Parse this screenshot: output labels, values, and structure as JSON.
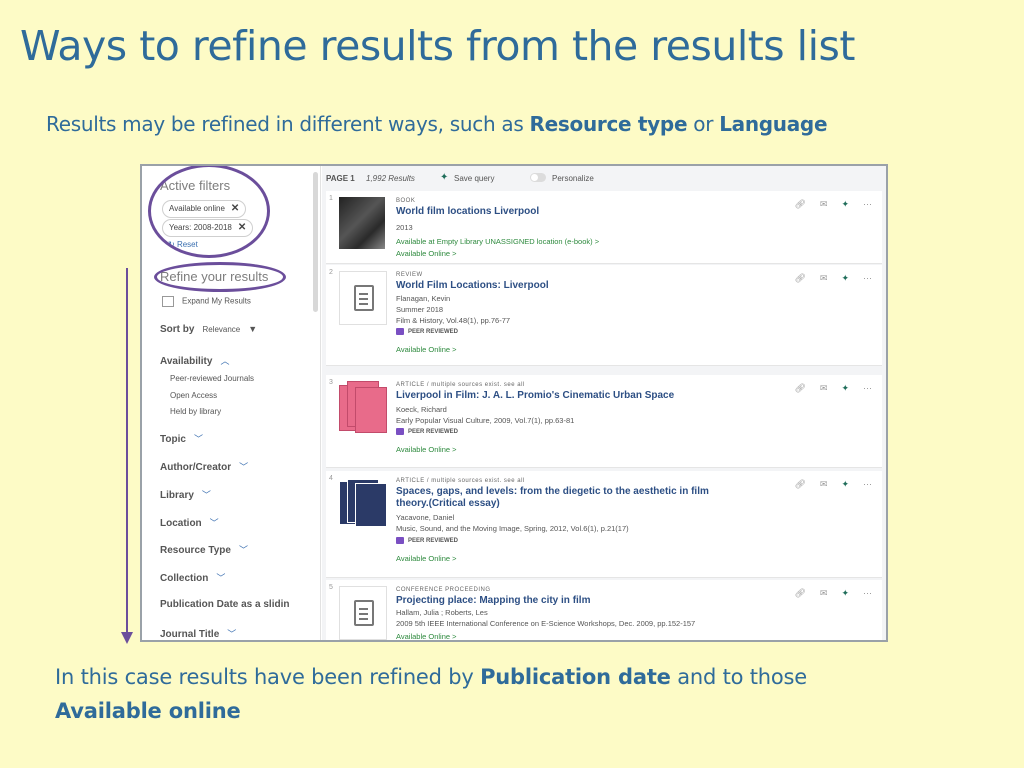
{
  "slide": {
    "title": "Ways to refine results from the results list",
    "intro_prefix": "Results may be refined in different ways, such as ",
    "intro_bold1": "Resource type",
    "intro_mid": " or ",
    "intro_bold2": "Language",
    "footer_prefix": "In this case results have been refined by ",
    "footer_bold1": "Publication date",
    "footer_mid": " and to those ",
    "footer_bold2": "Available online"
  },
  "sidebar": {
    "active_filters": "Active filters",
    "chips": [
      "Available online",
      "Years: 2008-2018"
    ],
    "reset": "Reset",
    "refine": "Refine your results",
    "expand": "Expand My Results",
    "sort_label": "Sort by",
    "sort_value": "Relevance",
    "availability": "Availability",
    "availability_items": [
      "Peer-reviewed Journals",
      "Open Access",
      "Held by library"
    ],
    "facets": [
      "Topic",
      "Author/Creator",
      "Library",
      "Location",
      "Resource Type",
      "Collection",
      "Publication Date as a slidin",
      "Journal Title"
    ]
  },
  "topbar": {
    "page": "PAGE 1",
    "count": "1,992 Results",
    "save": "Save query",
    "personalize": "Personalize"
  },
  "results": [
    {
      "num": "1",
      "type": "BOOK",
      "title": "World film locations Liverpool",
      "meta": [
        "2013"
      ],
      "peer": "",
      "avail": [
        "Available at Empty Library  UNASSIGNED location (e-book)  >",
        "Available Online  >"
      ]
    },
    {
      "num": "2",
      "type": "REVIEW",
      "title": "World Film Locations: Liverpool",
      "meta": [
        "Flanagan, Kevin",
        "Summer 2018",
        "Film & History, Vol.48(1), pp.76-77"
      ],
      "peer": "PEER REVIEWED",
      "avail": [
        "Available Online  >"
      ]
    },
    {
      "num": "3",
      "type": "ARTICLE / multiple sources exist. see all",
      "title": "Liverpool in Film: J. A. L. Promio's Cinematic Urban Space",
      "meta": [
        "Koeck, Richard",
        "Early Popular Visual Culture, 2009, Vol.7(1), pp.63-81"
      ],
      "peer": "PEER REVIEWED",
      "avail": [
        "Available Online  >"
      ]
    },
    {
      "num": "4",
      "type": "ARTICLE / multiple sources exist. see all",
      "title": "Spaces, gaps, and levels: from the diegetic to the aesthetic in film theory.(Critical essay)",
      "meta": [
        "Yacavone, Daniel",
        "Music, Sound, and the Moving Image, Spring, 2012, Vol.6(1), p.21(17)"
      ],
      "peer": "PEER REVIEWED",
      "avail": [
        "Available Online  >"
      ]
    },
    {
      "num": "5",
      "type": "CONFERENCE PROCEEDING",
      "title": "Projecting place: Mapping the city in film",
      "meta": [
        "Hallam, Julia ; Roberts, Les",
        "2009 5th IEEE International Conference on E-Science Workshops, Dec. 2009, pp.152-157"
      ],
      "peer": "",
      "avail": [
        "Available Online  >"
      ]
    }
  ],
  "icons": {
    "link": "link-icon",
    "email": "email-icon",
    "pin": "pin-icon",
    "more": "more-icon"
  },
  "colors": {
    "background": "#fdfbc6",
    "heading": "#2f6b9a",
    "ring": "#6b4e9b"
  }
}
